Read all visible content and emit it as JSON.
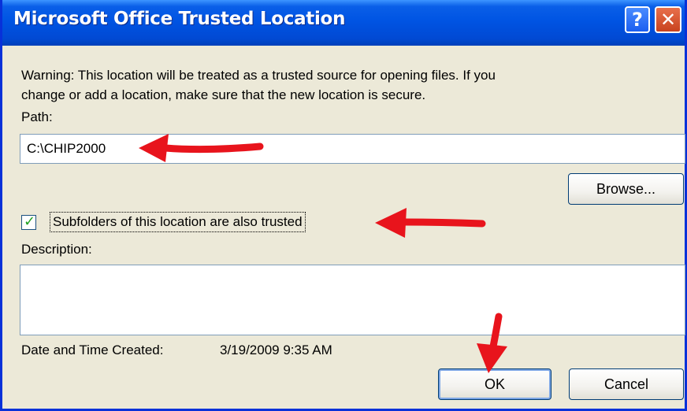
{
  "dialog": {
    "title": "Microsoft Office Trusted Location",
    "help_glyph": "?",
    "close_glyph": "✕",
    "warning_line1": "Warning: This location will be treated as a trusted source for opening files. If you",
    "warning_line2": "change or add a location, make sure that the new location is secure.",
    "path_label": "Path:",
    "path_value": "C:\\CHIP2000",
    "browse_label": "Browse...",
    "subfolders_checked": true,
    "subfolders_label": "Subfolders of this location are also trusted",
    "description_label": "Description:",
    "description_value": "",
    "created_label": "Date and Time Created:",
    "created_value": "3/19/2009 9:35 AM",
    "ok_label": "OK",
    "cancel_label": "Cancel"
  },
  "annotations": {
    "arrow_color": "#e8141c"
  },
  "colors": {
    "titlebar": "#0054e3",
    "dialog_bg": "#ece9d8",
    "checkmark": "#21a121"
  }
}
